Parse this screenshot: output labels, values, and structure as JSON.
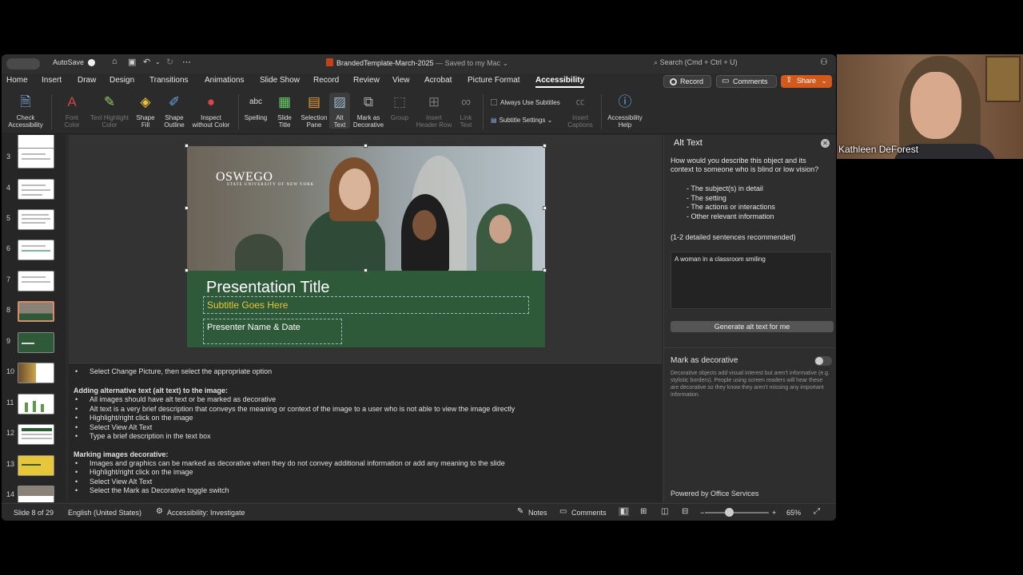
{
  "titlebar": {
    "autosave": "AutoSave",
    "document": "BrandedTemplate-March-2025",
    "saved": "— Saved to my Mac",
    "search": "Search (Cmd + Ctrl + U)"
  },
  "menu": [
    "Home",
    "Insert",
    "Draw",
    "Design",
    "Transitions",
    "Animations",
    "Slide Show",
    "Record",
    "Review",
    "View",
    "Acrobat",
    "Picture Format",
    "Accessibility"
  ],
  "menu_active": "Accessibility",
  "actions": {
    "record": "Record",
    "comments": "Comments",
    "share": "Share"
  },
  "ribbon": {
    "check_accessibility": [
      "Check",
      "Accessibility"
    ],
    "font_color": [
      "Font",
      "Color"
    ],
    "text_highlight": [
      "Text Highlight",
      "Color"
    ],
    "shape_fill": [
      "Shape",
      "Fill"
    ],
    "shape_outline": [
      "Shape",
      "Outline"
    ],
    "inspect": [
      "Inspect",
      "without Color"
    ],
    "spelling": "Spelling",
    "slide_title": [
      "Slide",
      "Title"
    ],
    "selection_pane": [
      "Selection",
      "Pane"
    ],
    "alt_text": [
      "Alt",
      "Text"
    ],
    "mark_decorative": [
      "Mark as",
      "Decorative"
    ],
    "group": "Group",
    "insert_header_row": [
      "Insert",
      "Header Row"
    ],
    "link_text": [
      "Link",
      "Text"
    ],
    "always_use_subtitles": "Always Use Subtitles",
    "subtitle_settings": "Subtitle Settings",
    "insert_captions": [
      "Insert",
      "Captions"
    ],
    "accessibility_help": [
      "Accessibility",
      "Help"
    ],
    "icons": {
      "spelling": "abc"
    }
  },
  "thumbnails": [
    "3",
    "4",
    "5",
    "6",
    "7",
    "8",
    "9",
    "10",
    "11",
    "12",
    "13",
    "14"
  ],
  "slide": {
    "logo": "OSWEGO",
    "logo_sub": "STATE UNIVERSITY OF NEW YORK",
    "title": "Presentation Title",
    "subtitle": "Subtitle Goes Here",
    "presenter": "Presenter Name & Date"
  },
  "notes": {
    "lines": [
      {
        "type": "bullet",
        "text": "Select Change Picture, then select the appropriate option"
      },
      {
        "type": "heading",
        "text": "Adding alternative text (alt text) to the image:"
      },
      {
        "type": "bullet",
        "text": "All images should have alt text or be marked as decorative"
      },
      {
        "type": "bullet",
        "text": "Alt text is a very brief description that conveys the meaning or context of the image to a user who is not able to view the image directly"
      },
      {
        "type": "bullet",
        "text": "Highlight/right click on the image"
      },
      {
        "type": "bullet",
        "text": "Select View Alt Text"
      },
      {
        "type": "bullet",
        "text": "Type a brief description in the text box"
      },
      {
        "type": "heading",
        "text": "Marking images decorative:"
      },
      {
        "type": "bullet",
        "text": "Images and graphics can be marked as decorative when they do not convey additional information or add any meaning to the slide"
      },
      {
        "type": "bullet",
        "text": "Highlight/right click on the image"
      },
      {
        "type": "bullet",
        "text": "Select View Alt Text"
      },
      {
        "type": "bullet",
        "text": "Select the Mark as Decorative toggle switch"
      }
    ]
  },
  "alt_panel": {
    "title": "Alt Text",
    "question": "How would you describe this object and its context to someone who is blind or low vision?",
    "items": [
      "- The subject(s) in detail",
      "- The setting",
      "- The actions or interactions",
      "- Other relevant information"
    ],
    "recommendation": "(1-2 detailed sentences recommended)",
    "value": "A woman in a classroom smiling",
    "generate": "Generate alt text for me",
    "decorative_label": "Mark as decorative",
    "decorative_desc": "Decorative objects add visual interest but aren't informative (e.g. stylistic borders). People using screen readers will hear these are decorative so they know they aren't missing any important information.",
    "powered": "Powered by Office Services",
    "decorative_on": false
  },
  "status": {
    "slide": "Slide 8 of 29",
    "language": "English (United States)",
    "accessibility": "Accessibility: Investigate",
    "notes": "Notes",
    "comments": "Comments",
    "zoom": "65%"
  },
  "webcam": {
    "name": "Kathleen DeForest"
  }
}
